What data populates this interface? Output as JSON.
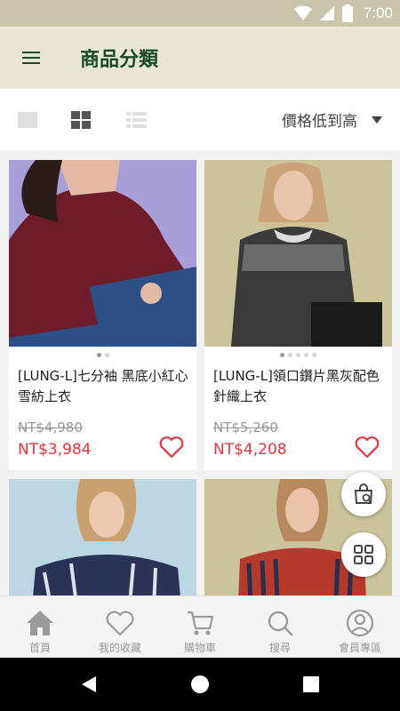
{
  "status_bar": {
    "time": "7:00"
  },
  "header": {
    "title": "商品分類"
  },
  "toolbar": {
    "sort_label": "價格低到高",
    "views": [
      "single",
      "grid",
      "list"
    ],
    "active_view": "grid"
  },
  "products": [
    {
      "title": "[LUNG-L]七分袖 黑底小紅心 雪紡上衣",
      "original_price": "NT$4,980",
      "sale_price": "NT$3,984",
      "image_count": 2,
      "active_image": 0
    },
    {
      "title": "[LUNG-L]領口鑽片黑灰配色針織上衣",
      "original_price": "NT$5,260",
      "sale_price": "NT$4,208",
      "image_count": 5,
      "active_image": 0
    },
    {
      "title": "",
      "original_price": "",
      "sale_price": ""
    },
    {
      "title": "",
      "original_price": "",
      "sale_price": ""
    }
  ],
  "fabs": [
    {
      "icon": "shopping-bag-icon"
    },
    {
      "icon": "category-grid-icon"
    }
  ],
  "bottom_nav": [
    {
      "label": "首頁",
      "icon": "home-icon"
    },
    {
      "label": "我的收藏",
      "icon": "heart-icon"
    },
    {
      "label": "購物車",
      "icon": "cart-icon"
    },
    {
      "label": "搜尋",
      "icon": "search-icon"
    },
    {
      "label": "會員專區",
      "icon": "user-icon"
    }
  ],
  "colors": {
    "status_bar": "#c9c4ac",
    "header_bg": "#eae6d6",
    "title": "#1e4a2c",
    "price": "#e8333f",
    "nav_inactive": "#999999"
  }
}
